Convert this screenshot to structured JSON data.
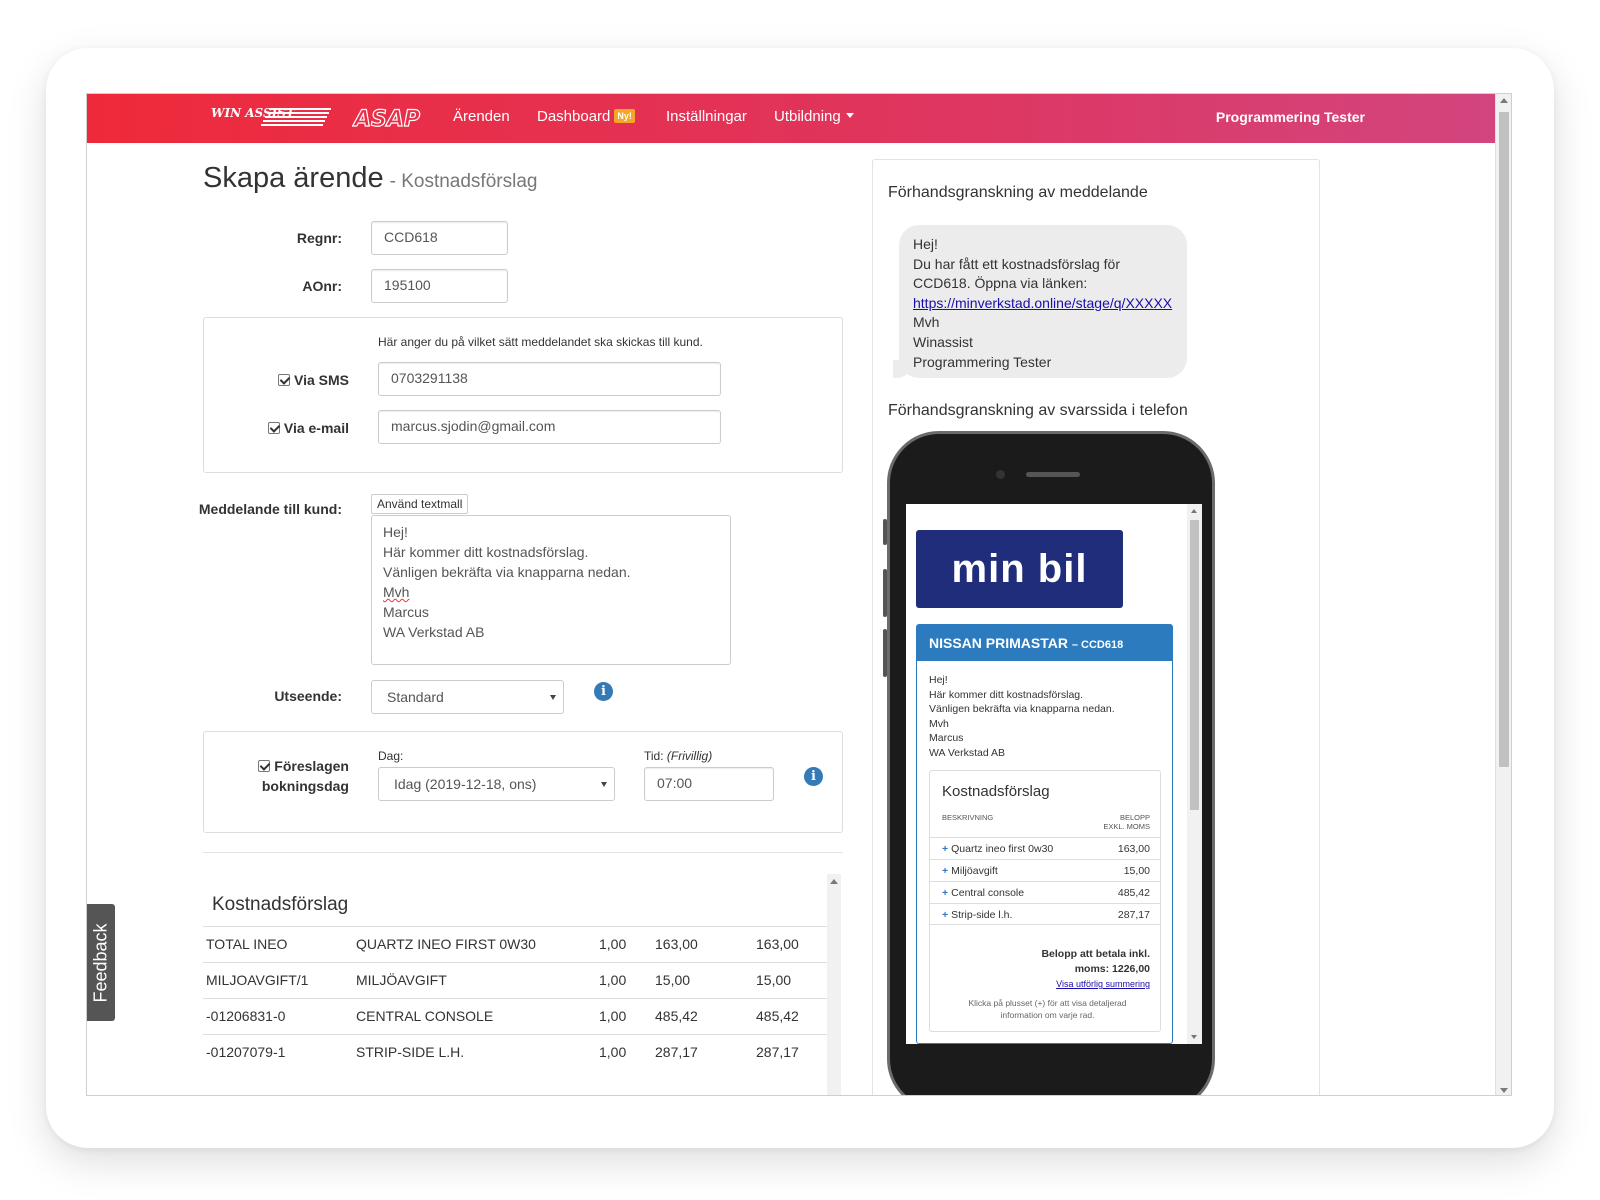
{
  "nav": {
    "brand_win": "WIN ASSIST",
    "brand_asap": "ASAP",
    "items": [
      "Ärenden",
      "Dashboard",
      "Inställningar",
      "Utbildning"
    ],
    "dashboard_badge": "Ny!",
    "user": "Programmering Tester"
  },
  "page": {
    "title": "Skapa ärende",
    "subtitle": "- Kostnadsförslag"
  },
  "form": {
    "regnr_label": "Regnr:",
    "regnr_value": "CCD618",
    "aonr_label": "AOnr:",
    "aonr_value": "195100",
    "send_hint": "Här anger du på vilket sätt meddelandet ska skickas till kund.",
    "sms_label": "Via SMS",
    "sms_value": "0703291138",
    "email_label": "Via e-mail",
    "email_value": "marcus.sjodin@gmail.com",
    "message_label": "Meddelande till kund:",
    "template_button": "Använd textmall",
    "message_lines": [
      "Hej!",
      "Här kommer ditt kostnadsförslag.",
      "Vänligen bekräfta via knapparna nedan.",
      "Mvh",
      "Marcus",
      "WA Verkstad AB"
    ],
    "appearance_label": "Utseende:",
    "appearance_value": "Standard",
    "booking_label_1": "Föreslagen",
    "booking_label_2": "bokningsdag",
    "day_label": "Dag:",
    "day_value": "Idag (2019-12-18, ons)",
    "time_label": "Tid:",
    "time_optional": "(Frivillig)",
    "time_value": "07:00"
  },
  "cost": {
    "title": "Kostnadsförslag",
    "rows": [
      {
        "code": "TOTAL INEO",
        "desc": "QUARTZ INEO FIRST 0W30",
        "qty": "1,00",
        "price": "163,00",
        "sum": "163,00"
      },
      {
        "code": "MILJOAVGIFT/1",
        "desc": "MILJÖAVGIFT",
        "qty": "1,00",
        "price": "15,00",
        "sum": "15,00"
      },
      {
        "code": "-01206831-0",
        "desc": "CENTRAL CONSOLE",
        "qty": "1,00",
        "price": "485,42",
        "sum": "485,42"
      },
      {
        "code": "-01207079-1",
        "desc": "STRIP-SIDE L.H.",
        "qty": "1,00",
        "price": "287,17",
        "sum": "287,17"
      }
    ]
  },
  "feedback": "Feedback",
  "preview": {
    "msg_title": "Förhandsgranskning av meddelande",
    "msg_lines": [
      "Hej!",
      "Du har fått ett kostnadsförslag för",
      "CCD618. Öppna via länken:"
    ],
    "msg_link": "https://minverkstad.online/stage/q/XXXXX",
    "msg_sign": [
      "Mvh",
      "Winassist",
      "Programmering Tester"
    ],
    "phone_title": "Förhandsgranskning av svarssida i telefon",
    "phone": {
      "logo": "min bil",
      "car": "NISSAN PRIMASTAR",
      "regnr": "– CCD618",
      "message": "Hej!\nHär kommer ditt kostnadsförslag.\nVänligen bekräfta via knapparna nedan.\nMvh\nMarcus\nWA Verkstad AB",
      "kf_title": "Kostnadsförslag",
      "col_desc": "BESKRIVNING",
      "col_amount": "BELOPP",
      "col_amount_sub": "EXKL. MOMS",
      "rows": [
        {
          "desc": "Quartz ineo first 0w30",
          "amount": "163,00"
        },
        {
          "desc": "Miljöavgift",
          "amount": "15,00"
        },
        {
          "desc": "Central console",
          "amount": "485,42"
        },
        {
          "desc": "Strip-side l.h.",
          "amount": "287,17"
        }
      ],
      "total_1": "Belopp att betala inkl.",
      "total_2": "moms: 1226,00",
      "summary_link": "Visa utförlig summering",
      "note": "Klicka på plusset (+) för att visa detaljerad information om varje rad."
    }
  },
  "colors": {
    "nav_start": "#ee2a3a",
    "nav_end": "#d2457e",
    "brand_blue": "#1f2d7a",
    "accent_blue": "#2d7bbf",
    "badge": "#f5a623"
  }
}
